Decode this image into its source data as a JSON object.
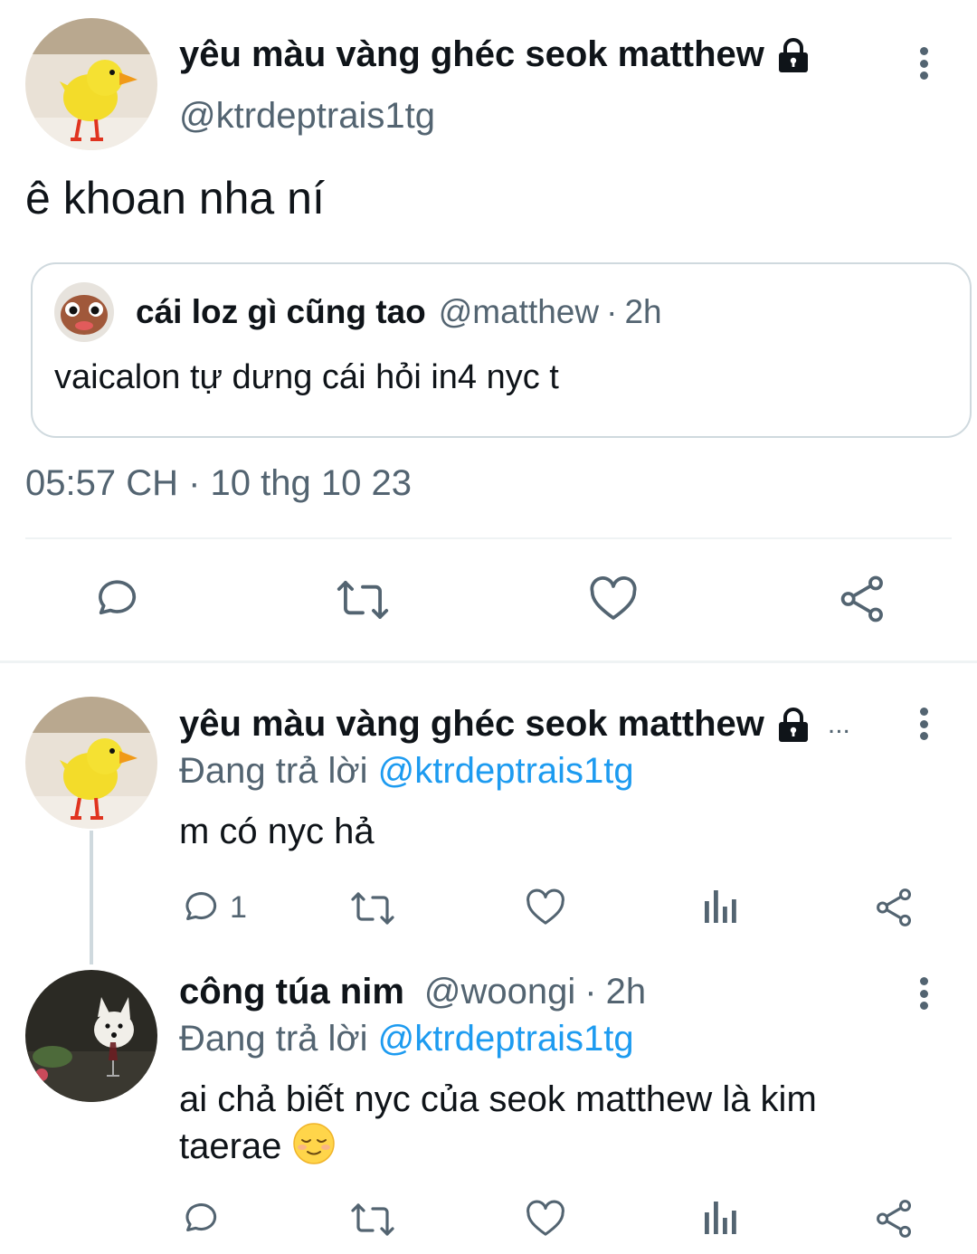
{
  "main_tweet": {
    "display_name": "yêu màu vàng ghéc seok matthew",
    "handle": "@ktrdeptrais1tg",
    "text": "ê khoan nha ní",
    "quoted": {
      "display_name": "cái loz gì cũng tao",
      "handle": "@matthew",
      "separator": "·",
      "time": "2h",
      "text": "vaicalon tự dưng cái hỏi in4 nyc t"
    },
    "timestamp": "05:57 CH · 10 thg 10 23",
    "actions": [
      "reply-icon",
      "retweet-icon",
      "like-icon",
      "share-icon"
    ]
  },
  "replies": [
    {
      "display_name": "yêu màu vàng ghéc seok matthew",
      "truncation": "...",
      "replying_prefix": "Đang trả lời",
      "replying_to": "@ktrdeptrais1tg",
      "text": "m có nyc hả",
      "reply_count": "1"
    },
    {
      "display_name": "công túa nim",
      "handle": "@woongi",
      "separator": "·",
      "time": "2h",
      "replying_prefix": "Đang trả lời",
      "replying_to": "@ktrdeptrais1tg",
      "text": "ai chả biết nyc của seok matthew là kim taerae",
      "emoji": "relieved-face-emoji"
    }
  ],
  "colors": {
    "text": "#0f1419",
    "secondary": "#536471",
    "link": "#1d9bf0",
    "border": "#cfd9de"
  }
}
